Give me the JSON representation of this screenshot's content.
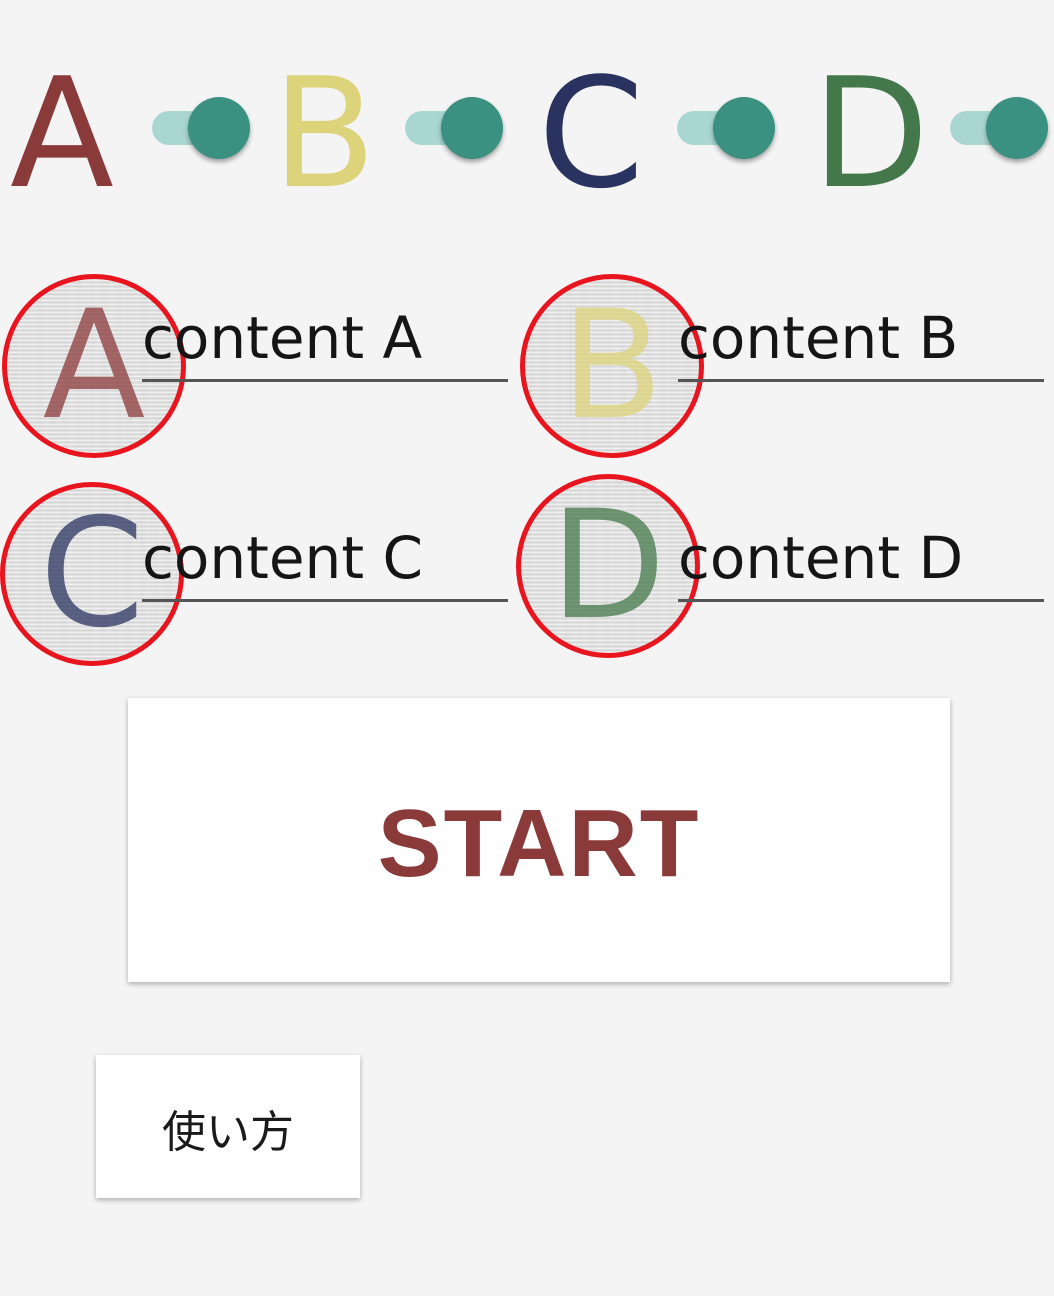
{
  "colors": {
    "a": "#8b3a3a",
    "b": "#dcd37a",
    "c": "#2a3360",
    "d": "#44784a",
    "switch_track": "#a9d6d0",
    "switch_thumb": "#3a9182",
    "badge_ring": "#e8141e",
    "start_text": "#8b3a3a"
  },
  "toggles": [
    {
      "letter": "A",
      "checked": true
    },
    {
      "letter": "B",
      "checked": true
    },
    {
      "letter": "C",
      "checked": true
    },
    {
      "letter": "D",
      "checked": true
    }
  ],
  "options": [
    {
      "letter": "A",
      "value": "content A"
    },
    {
      "letter": "B",
      "value": "content B"
    },
    {
      "letter": "C",
      "value": "content C"
    },
    {
      "letter": "D",
      "value": "content D"
    }
  ],
  "start_button": {
    "label": "START"
  },
  "howto_button": {
    "label": "使い方"
  }
}
